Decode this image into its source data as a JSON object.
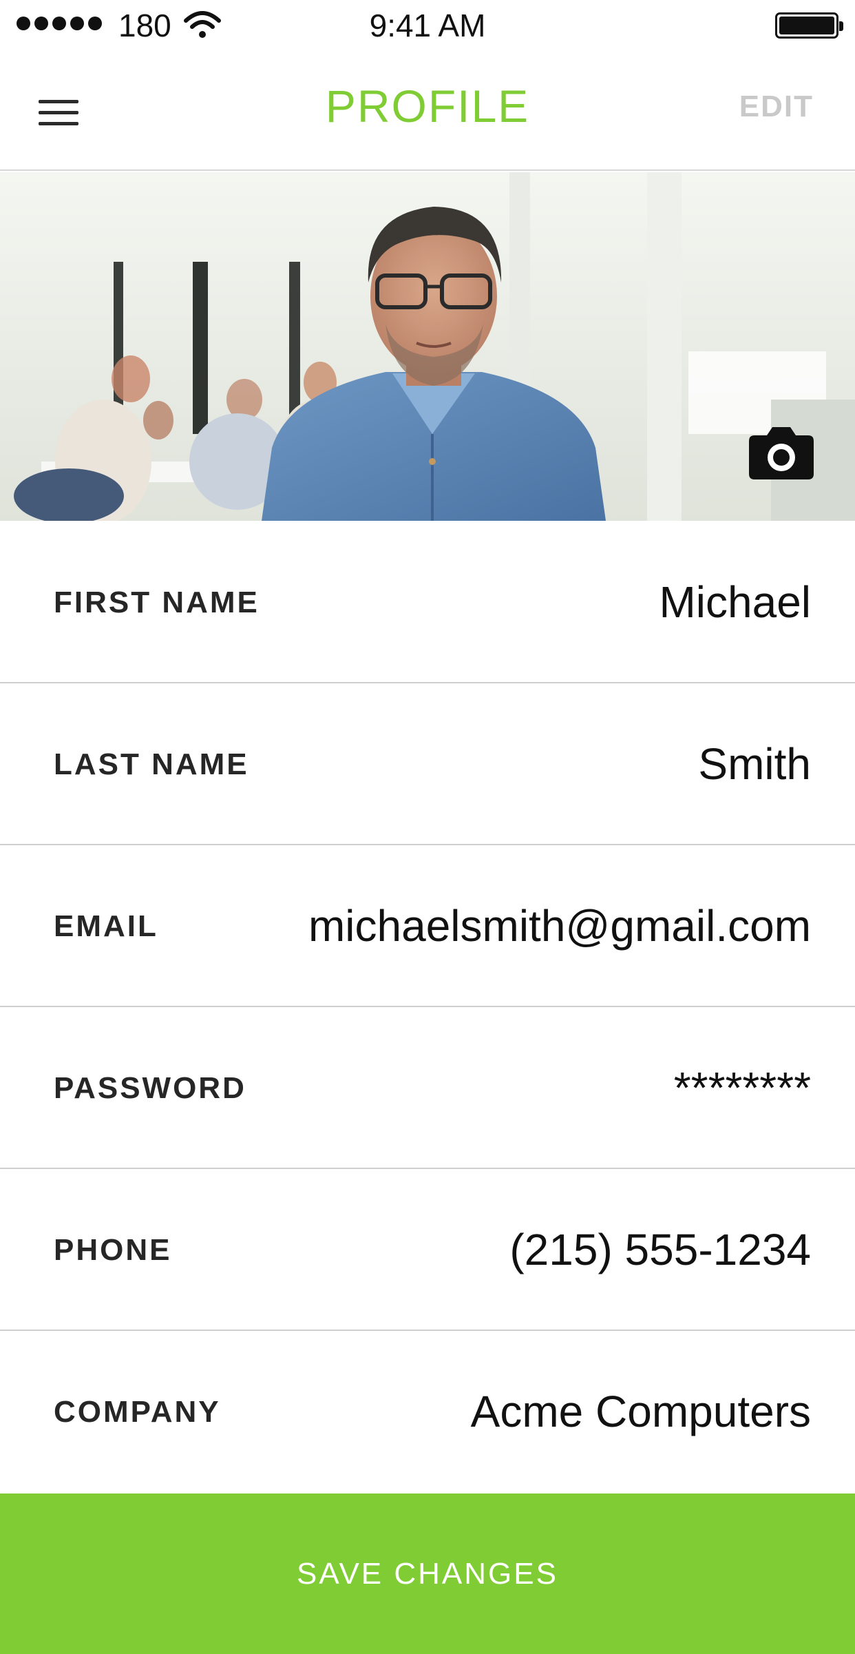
{
  "status_bar": {
    "carrier": "180",
    "time": "9:41 AM"
  },
  "header": {
    "title": "PROFILE",
    "edit_label": "EDIT",
    "menu_icon": "hamburger-menu-icon"
  },
  "photo": {
    "camera_icon": "camera-icon"
  },
  "fields": [
    {
      "label": "FIRST NAME",
      "value": "Michael"
    },
    {
      "label": "LAST NAME",
      "value": "Smith"
    },
    {
      "label": "EMAIL",
      "value": "michaelsmith@gmail.com"
    },
    {
      "label": "PASSWORD",
      "value": "********"
    },
    {
      "label": "PHONE",
      "value": "(215) 555-1234"
    },
    {
      "label": "COMPANY",
      "value": "Acme Computers"
    }
  ],
  "footer": {
    "save_label": "SAVE CHANGES"
  },
  "colors": {
    "accent": "#80cc35",
    "edit_disabled": "#c9c9c9",
    "divider": "#cfcfcf"
  }
}
